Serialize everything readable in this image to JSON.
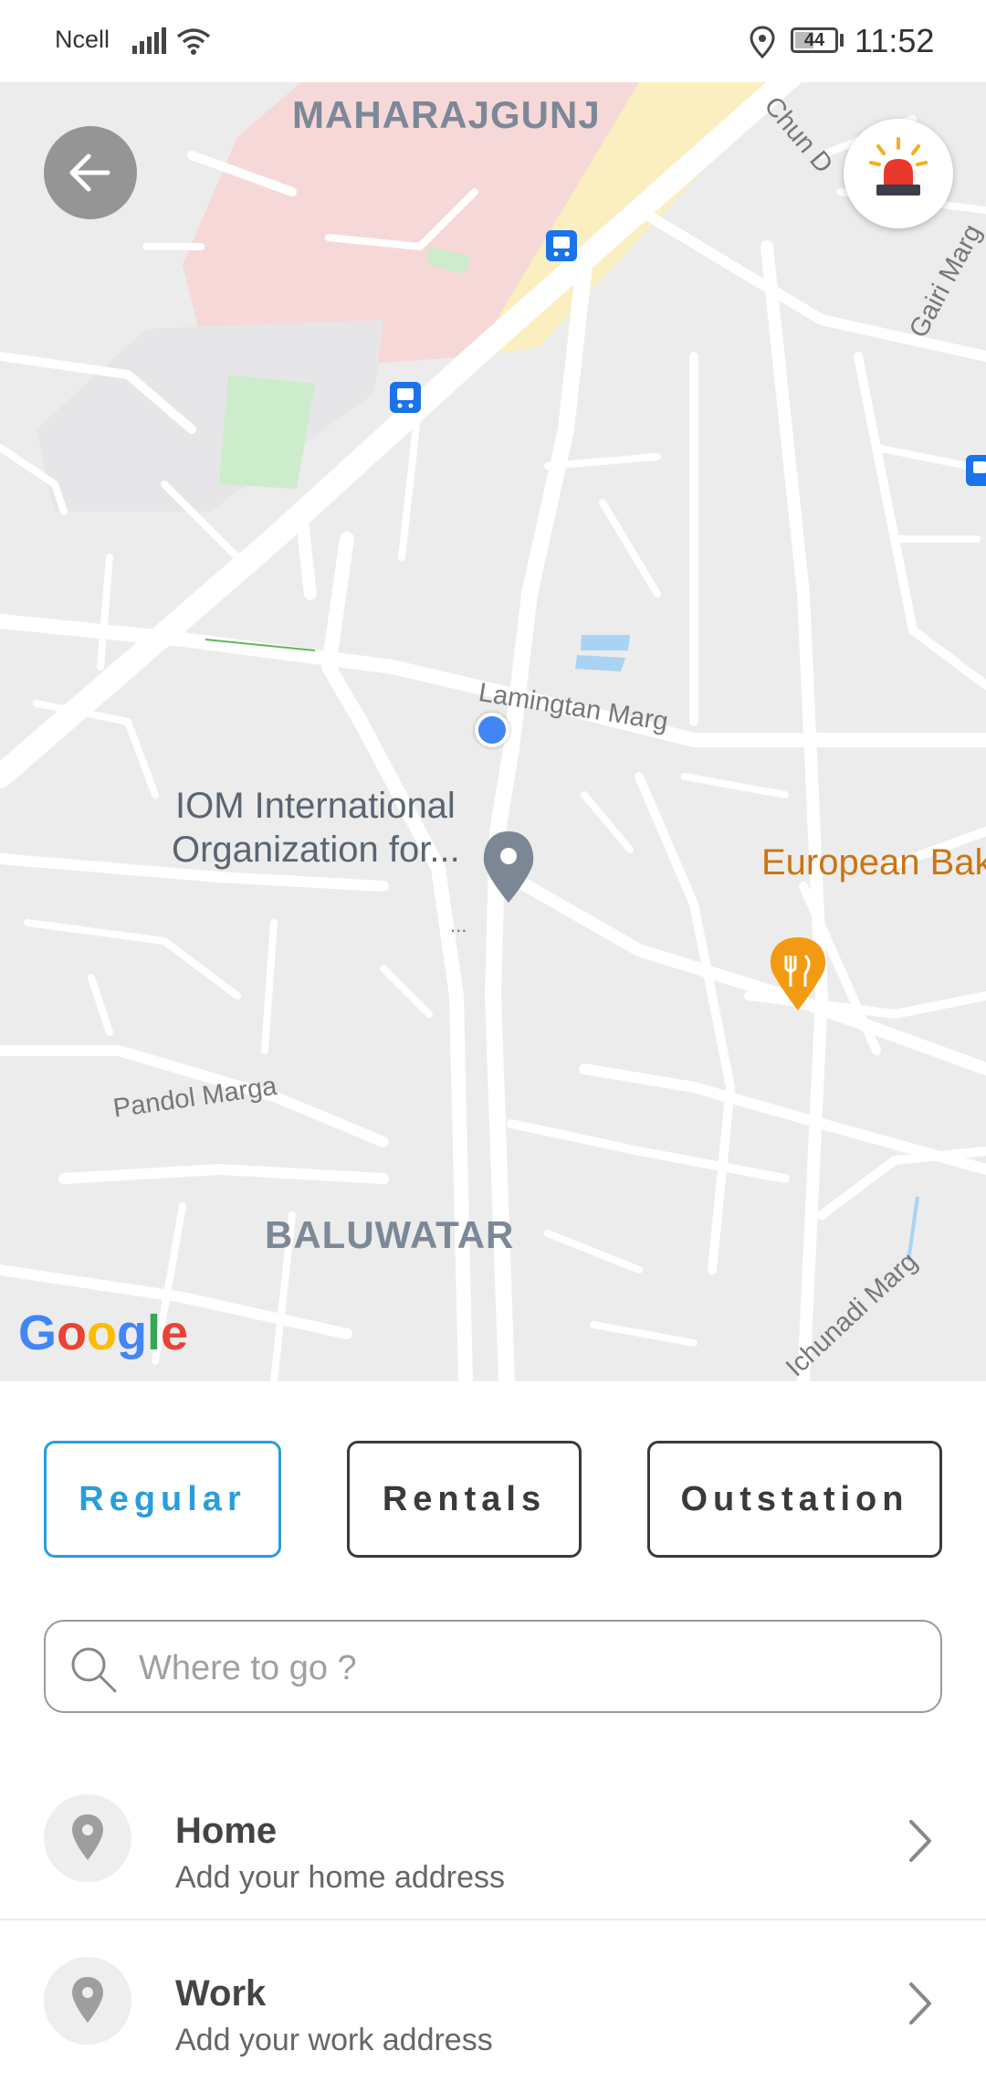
{
  "status_bar": {
    "carrier": "Ncell",
    "battery": "44",
    "time": "11:52",
    "icons": [
      "signal-icon",
      "wifi-icon",
      "location-icon",
      "battery-icon"
    ]
  },
  "map": {
    "labels": {
      "maharajgunj": "MAHARAJGUNJ",
      "baluwatar": "BALUWATAR",
      "lamingtan": "Lamingtan Marg",
      "pandol": "Pandol Marga",
      "ichunadi": "Ichunadi Marg",
      "gairi": "Gairi Marg",
      "chun": "Chun D",
      "iom_line1": "IOM International",
      "iom_line2": "Organization for...",
      "iom_more": "...",
      "bakery": "European Bak"
    },
    "attribution": "Google",
    "colors": {
      "background": "#ececec",
      "road": "#ffffff",
      "hospital_area": "#f7d8d8",
      "main_road": "#fbeec1",
      "park": "#cdeccb",
      "water": "#a9d3f2",
      "transit": "#1a73e8",
      "user_location": "#4285f4",
      "restaurant_pin": "#f29b12"
    },
    "controls": {
      "back_icon": "arrow-left-icon",
      "emergency_icon": "siren-icon"
    }
  },
  "ride_types": {
    "regular": "Regular",
    "rentals": "Rentals",
    "outstation": "Outstation",
    "selected": "Regular",
    "accent_color": "#2a9ddb"
  },
  "search": {
    "placeholder": "Where to go ?",
    "value": ""
  },
  "saved_places": [
    {
      "title": "Home",
      "subtitle": "Add your home address",
      "icon": "location-pin-icon"
    },
    {
      "title": "Work",
      "subtitle": "Add your work address",
      "icon": "location-pin-icon"
    }
  ]
}
